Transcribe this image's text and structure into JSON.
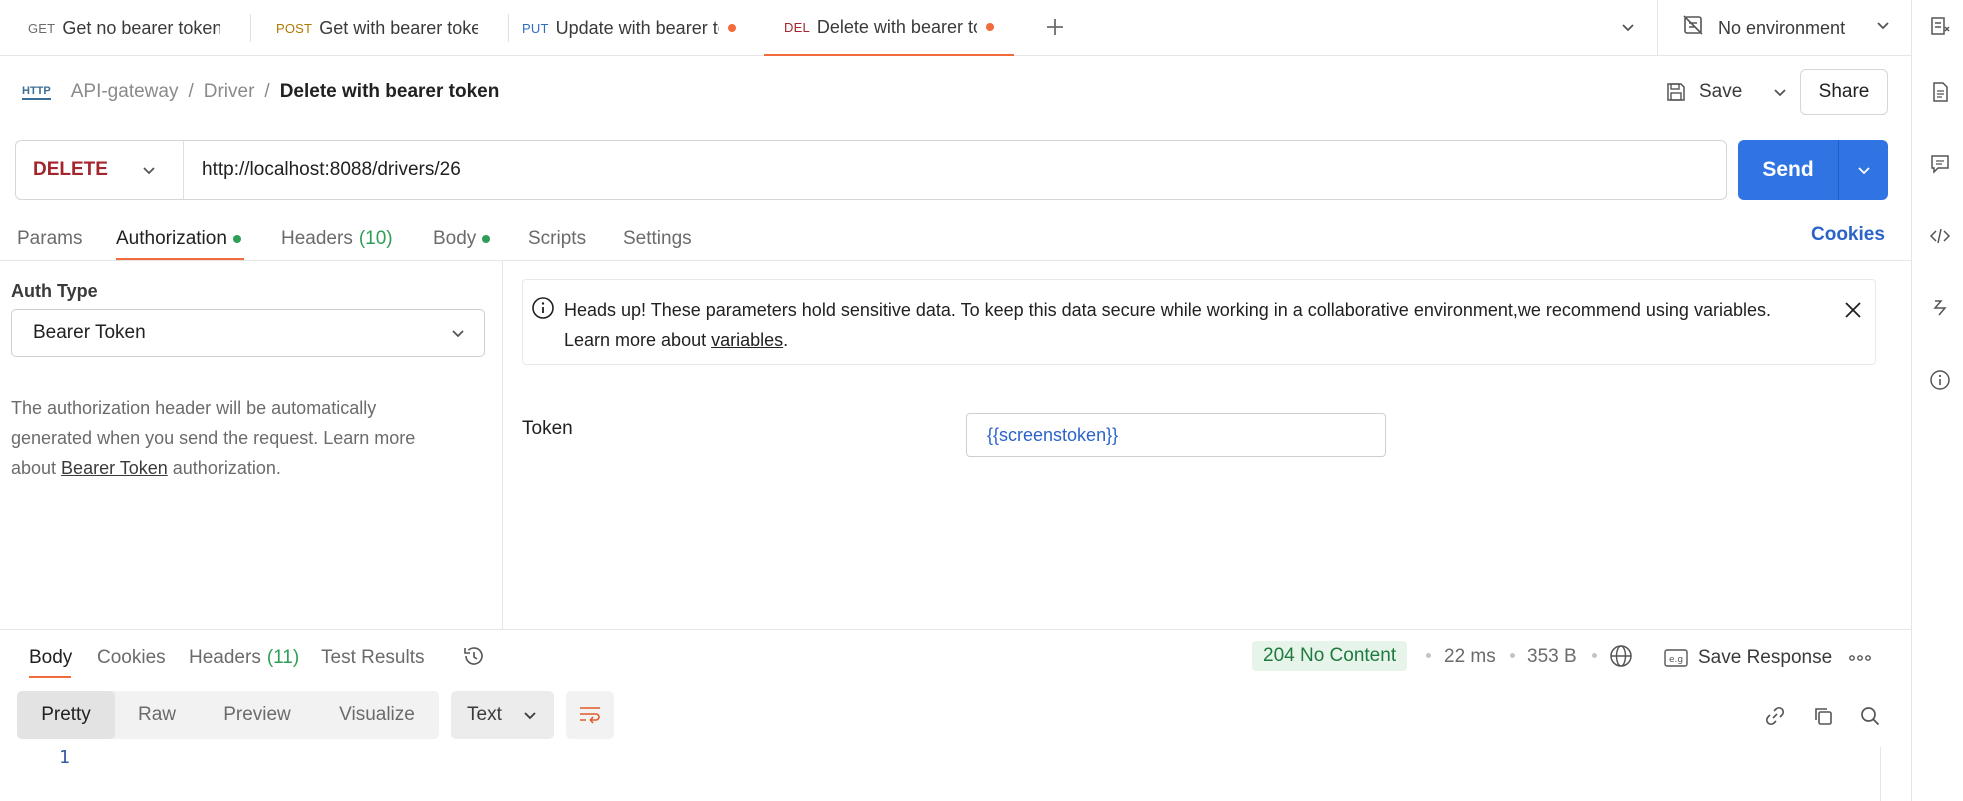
{
  "tabs": [
    {
      "method": "GET",
      "label": "Get no bearer token",
      "unsaved": false,
      "active": false
    },
    {
      "method": "POST",
      "label": "Get with bearer token",
      "unsaved": false,
      "active": false
    },
    {
      "method": "PUT",
      "label": "Update with bearer toke",
      "unsaved": true,
      "active": false
    },
    {
      "method": "DEL",
      "label": "Delete with bearer toke",
      "unsaved": true,
      "active": true
    }
  ],
  "environment": {
    "label": "No environment"
  },
  "breadcrumb": {
    "badge": "HTTP",
    "collection": "API-gateway",
    "folder": "Driver",
    "request": "Delete with bearer token"
  },
  "toolbar": {
    "save_label": "Save",
    "share_label": "Share"
  },
  "request": {
    "method": "DELETE",
    "url": "http://localhost:8088/drivers/26",
    "send_label": "Send"
  },
  "request_tabs": [
    {
      "label": "Params"
    },
    {
      "label": "Authorization",
      "dot": true
    },
    {
      "label": "Headers",
      "count": "(10)"
    },
    {
      "label": "Body",
      "dot": true
    },
    {
      "label": "Scripts"
    },
    {
      "label": "Settings"
    }
  ],
  "cookies_label": "Cookies",
  "auth": {
    "type_label": "Auth Type",
    "type_value": "Bearer Token",
    "desc_before": "The authorization header will be automatically generated when you send the request. Learn more about ",
    "desc_link": "Bearer Token",
    "desc_after": " authorization.",
    "banner_text": "Heads up! These parameters hold sensitive data. To keep this data secure while working in a collaborative environment,we recommend using variables. Learn more about ",
    "banner_link": "variables",
    "banner_end": ".",
    "token_label": "Token",
    "token_value": "{{screenstoken}}"
  },
  "response": {
    "tabs": [
      {
        "label": "Body"
      },
      {
        "label": "Cookies"
      },
      {
        "label": "Headers",
        "count": "(11)"
      },
      {
        "label": "Test Results"
      }
    ],
    "status": "204 No Content",
    "time": "22 ms",
    "size": "353 B",
    "save_label": "Save Response",
    "view_modes": [
      "Pretty",
      "Raw",
      "Preview",
      "Visualize"
    ],
    "format": "Text",
    "line_number": "1"
  },
  "colors": {
    "accent": "#f26b3a",
    "send": "#2f74e2",
    "status_ok": "#1f7a3f",
    "delete": "#a4262c"
  }
}
